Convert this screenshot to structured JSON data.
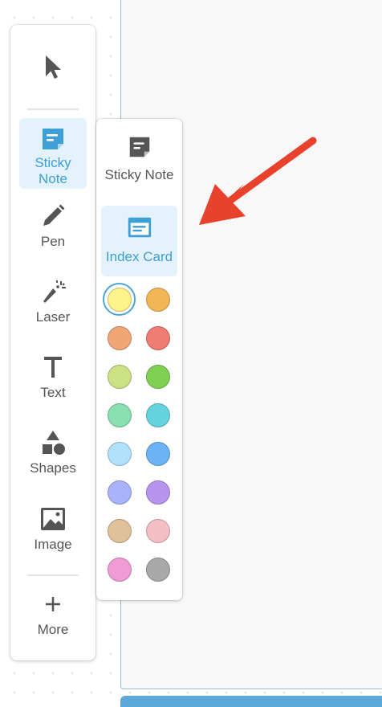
{
  "colors": {
    "accent": "#3d9fd3",
    "arrow": "#e8412c",
    "icon": "#555555"
  },
  "toolbar": {
    "tools": [
      {
        "id": "select",
        "label": "",
        "icon": "cursor-arrow-icon"
      },
      {
        "id": "sticky",
        "label": "Sticky Note",
        "icon": "sticky-note-icon",
        "active": true
      },
      {
        "id": "pen",
        "label": "Pen",
        "icon": "pen-icon"
      },
      {
        "id": "laser",
        "label": "Laser",
        "icon": "laser-pointer-icon"
      },
      {
        "id": "text",
        "label": "Text",
        "icon": "text-icon"
      },
      {
        "id": "shapes",
        "label": "Shapes",
        "icon": "shapes-icon"
      },
      {
        "id": "image",
        "label": "Image",
        "icon": "image-icon"
      },
      {
        "id": "more",
        "label": "More",
        "icon": "plus-icon"
      }
    ]
  },
  "flyout": {
    "options": [
      {
        "label": "Sticky Note",
        "icon": "sticky-note-icon",
        "active": false
      },
      {
        "label": "Index Card",
        "icon": "index-card-icon",
        "active": true
      }
    ],
    "swatches": [
      "#fff48a",
      "#f3b656",
      "#f2a575",
      "#ee7c72",
      "#cce184",
      "#80d153",
      "#88dfb0",
      "#64d3de",
      "#b1e0fb",
      "#6ab4f5",
      "#a9b3fb",
      "#b894ef",
      "#dfc19a",
      "#f5bec4",
      "#f19bd6",
      "#a9a9a9"
    ],
    "selected_swatch": 0
  }
}
